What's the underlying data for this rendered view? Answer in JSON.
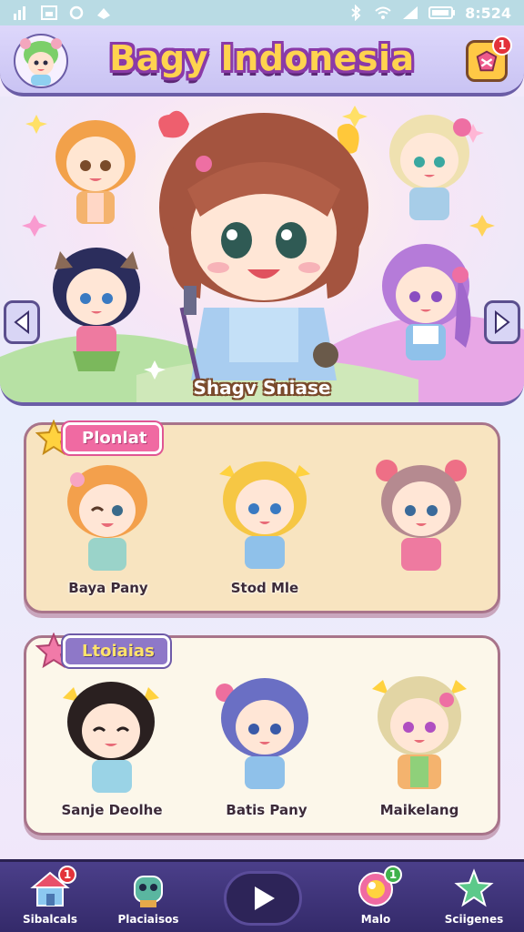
{
  "status_bar": {
    "time": "8:524"
  },
  "header": {
    "title": "Bagy Indonesia",
    "notification_count": "1"
  },
  "hero": {
    "featured_name": "Shagv Sniase"
  },
  "panels": [
    {
      "tag": "Plonlat",
      "cards": [
        {
          "name": "Baya Pany"
        },
        {
          "name": "Stod Mle"
        },
        {
          "name": ""
        }
      ]
    },
    {
      "tag": "Ltoiaias",
      "cards": [
        {
          "name": "Sanje Deolhe"
        },
        {
          "name": "Batis Pany"
        },
        {
          "name": "Maikelang"
        }
      ]
    }
  ],
  "bottom_nav": [
    {
      "label": "Sibalcals",
      "icon": "home-icon",
      "badge": "1"
    },
    {
      "label": "Placiaisos",
      "icon": "character-icon",
      "badge": ""
    },
    {
      "label": "",
      "icon": "play-icon",
      "badge": ""
    },
    {
      "label": "Malo",
      "icon": "orb-icon",
      "badge": "1"
    },
    {
      "label": "Sciigenes",
      "icon": "star-icon",
      "badge": ""
    }
  ],
  "colors": {
    "accent": "#6b5da6",
    "title_fill": "#ffd34f",
    "title_stroke": "#8a3aa8",
    "nav_bg": "#3c3179",
    "badge_red": "#e3323a",
    "badge_green": "#3fb24b"
  }
}
